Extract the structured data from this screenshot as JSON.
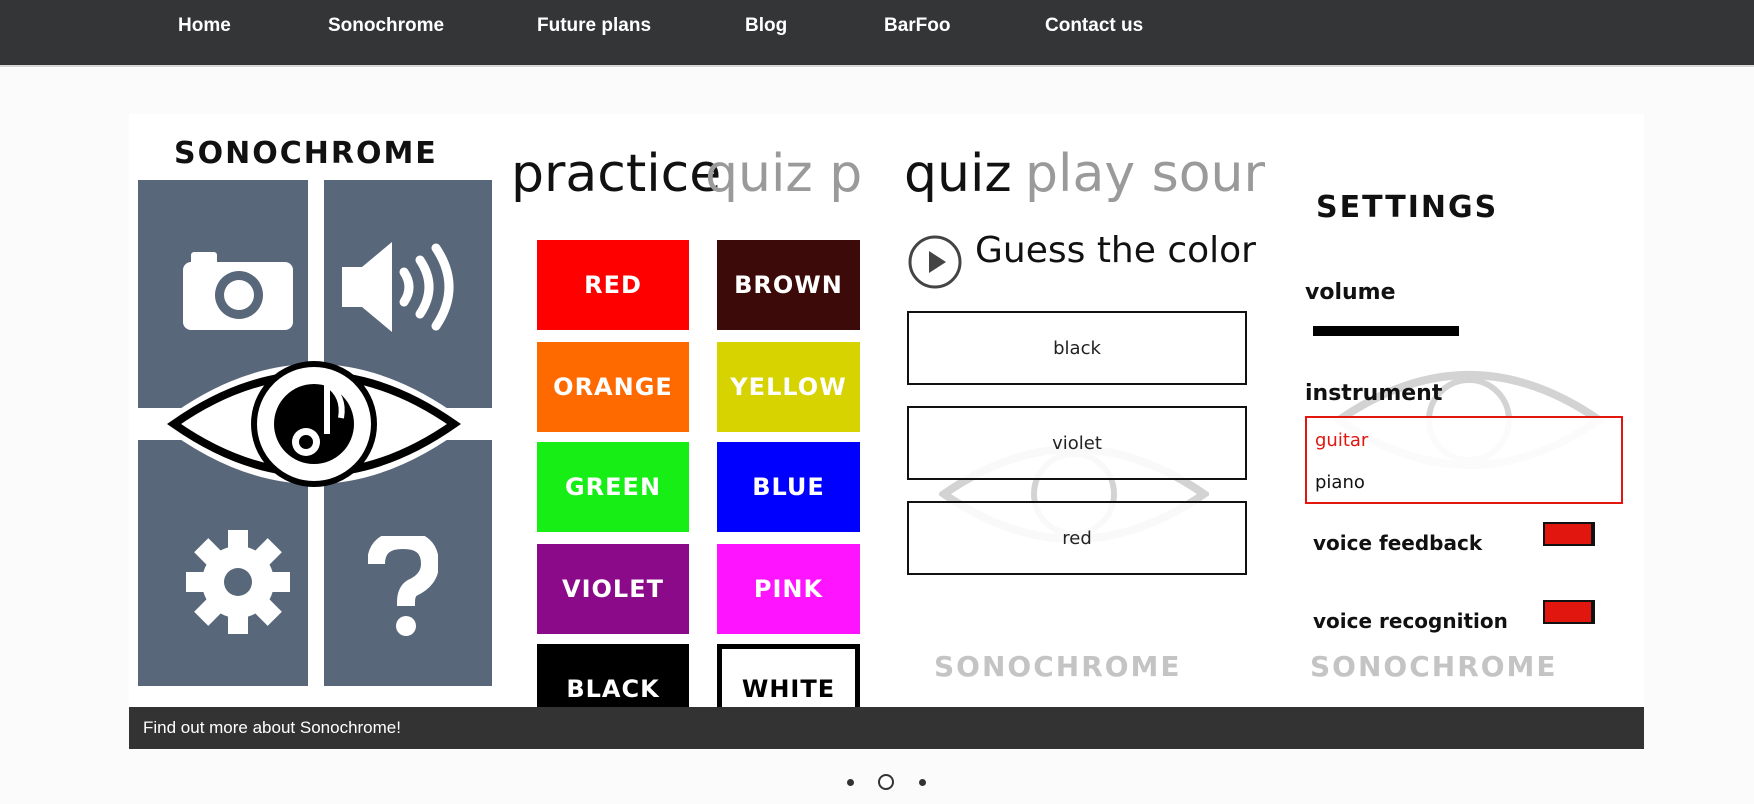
{
  "nav": {
    "items": [
      "Home",
      "Sonochrome",
      "Future plans",
      "Blog",
      "BarFoo",
      "Contact us"
    ]
  },
  "slide": {
    "menu_panel": {
      "logo": "SONOCHROME",
      "tiles": [
        "camera-icon",
        "speaker-icon",
        "gear-icon",
        "question-icon"
      ]
    },
    "practice_panel": {
      "tab_active": "practice",
      "tab_next": "quiz p",
      "colors": [
        {
          "label": "RED",
          "bg": "#ff0000"
        },
        {
          "label": "BROWN",
          "bg": "#3d0a0a"
        },
        {
          "label": "ORANGE",
          "bg": "#ff6a00"
        },
        {
          "label": "YELLOW",
          "bg": "#d6d300"
        },
        {
          "label": "GREEN",
          "bg": "#16ee16"
        },
        {
          "label": "BLUE",
          "bg": "#0000ff"
        },
        {
          "label": "VIOLET",
          "bg": "#8a0a8a"
        },
        {
          "label": "PINK",
          "bg": "#ff14ff"
        },
        {
          "label": "BLACK",
          "bg": "#000000"
        },
        {
          "label": "WHITE",
          "bg": "#ffffff"
        }
      ]
    },
    "quiz_panel": {
      "tab_active": "quiz",
      "tab_next": "play soun",
      "prompt": "Guess the color",
      "answers": [
        "black",
        "violet",
        "red"
      ],
      "watermark": "SONOCHROME"
    },
    "settings_panel": {
      "title": "SETTINGS",
      "volume_label": "volume",
      "instrument_label": "instrument",
      "instruments": [
        {
          "label": "guitar",
          "selected": true
        },
        {
          "label": "piano",
          "selected": false
        }
      ],
      "voice_feedback_label": "voice feedback",
      "voice_recognition_label": "voice recognition",
      "watermark": "SONOCHROME"
    }
  },
  "caption": {
    "text": "Find out more about Sonochrome!"
  },
  "pager": {
    "slides": 3,
    "active": 1
  },
  "colors": {
    "nav_bg": "#333537",
    "tile": "#586779",
    "toggle": "#e1160f",
    "selected_text": "#e1160f"
  }
}
